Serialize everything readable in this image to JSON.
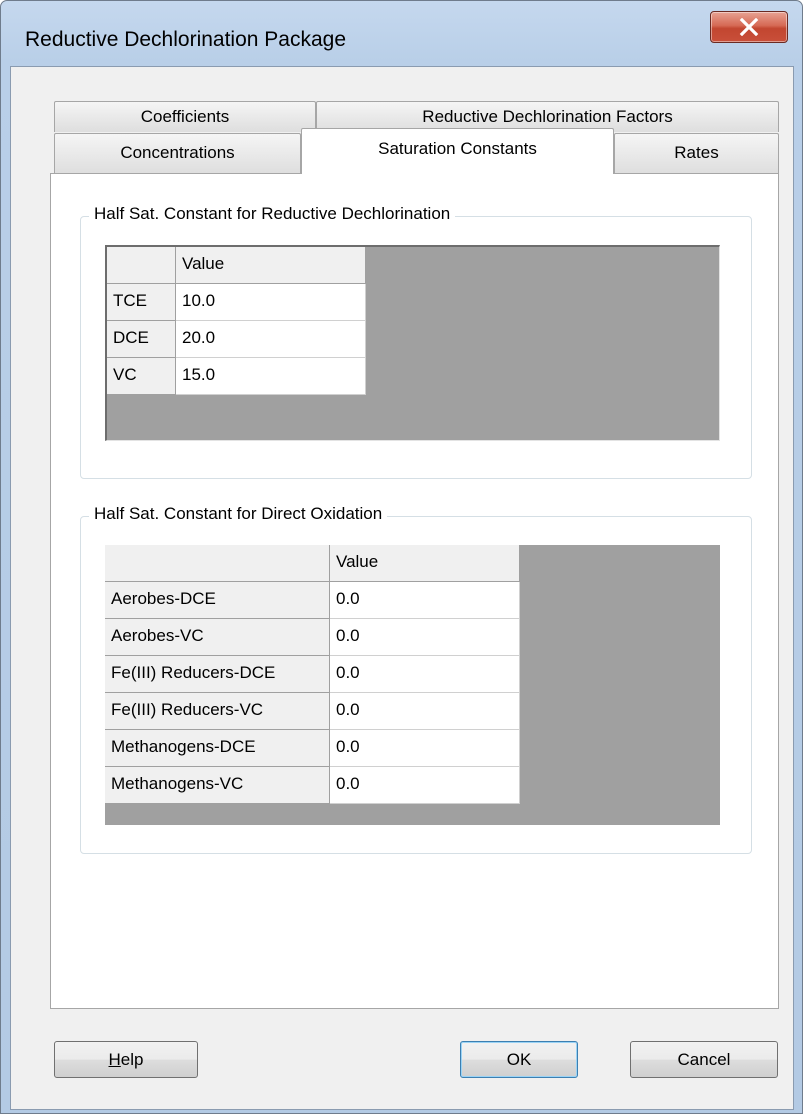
{
  "window": {
    "title": "Reductive Dechlorination Package",
    "close_icon": "close-icon"
  },
  "tabs": {
    "row_back": [
      "Coefficients",
      "Reductive Dechlorination Factors"
    ],
    "row_front": [
      "Concentrations",
      "Saturation Constants",
      "Rates"
    ],
    "active": "Saturation Constants"
  },
  "group1": {
    "caption": "Half Sat. Constant for Reductive Dechlorination",
    "header": "Value",
    "rows": [
      {
        "label": "TCE",
        "value": "10.0"
      },
      {
        "label": "DCE",
        "value": "20.0"
      },
      {
        "label": "VC",
        "value": "15.0"
      }
    ]
  },
  "group2": {
    "caption": "Half Sat. Constant for Direct Oxidation",
    "header": "Value",
    "rows": [
      {
        "label": "Aerobes-DCE",
        "value": "0.0"
      },
      {
        "label": "Aerobes-VC",
        "value": "0.0"
      },
      {
        "label": "Fe(III) Reducers-DCE",
        "value": "0.0"
      },
      {
        "label": "Fe(III) Reducers-VC",
        "value": "0.0"
      },
      {
        "label": "Methanogens-DCE",
        "value": "0.0"
      },
      {
        "label": "Methanogens-VC",
        "value": "0.0"
      }
    ]
  },
  "buttons": {
    "help_mnemonic": "H",
    "help_rest": "elp",
    "ok": "OK",
    "cancel": "Cancel"
  }
}
